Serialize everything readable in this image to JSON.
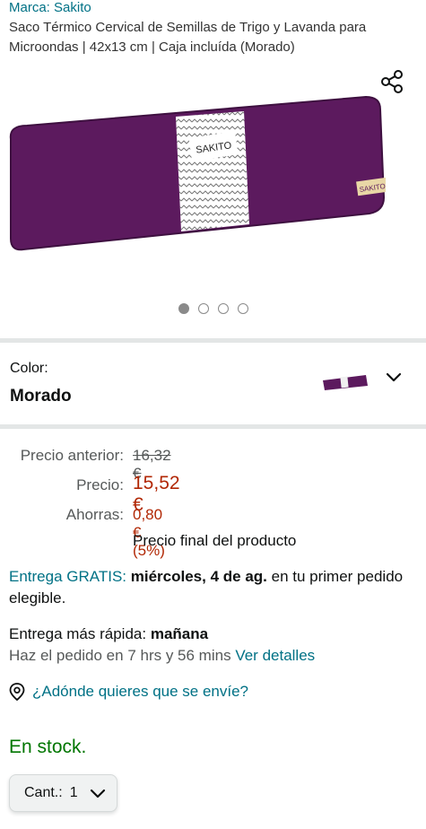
{
  "brand": "Marca: Sakito",
  "title": "Saco Térmico Cervical de Semillas de Trigo y Lavanda para Microondas | 42x13 cm | Caja incluída (Morado)",
  "product_image": {
    "band_text": "SAKITO",
    "tag_text": "SAKITO",
    "color": "#5c1a5e"
  },
  "carousel": {
    "total": 4,
    "active": 1
  },
  "color": {
    "label": "Color:",
    "value": "Morado"
  },
  "prices": {
    "previous_label": "Precio anterior:",
    "previous_value": "16,32 €",
    "price_label": "Precio:",
    "price_value": "15,52 €",
    "savings_label": "Ahorras:",
    "savings_value": "0,80 € (5%)",
    "final_note": "Precio final del producto"
  },
  "delivery": {
    "free_text": "Entrega GRATIS:",
    "date": "miércoles, 4 de ag.",
    "rest": "en tu primer pedido elegible."
  },
  "fastest": {
    "label": "Entrega más rápida:",
    "day": "mañana",
    "order_within": "Haz el pedido en 7 hrs y 56 mins",
    "details_link": "Ver detalles"
  },
  "location_link": "¿Adónde quieres que se envíe?",
  "stock": "En stock.",
  "quantity": {
    "label": "Cant.:",
    "value": "1"
  },
  "icons": {
    "share": "share-icon",
    "pin": "location-pin-icon",
    "chevron": "chevron-down-icon"
  },
  "colors": {
    "link": "#007185",
    "price": "#b12704",
    "stock": "#007600"
  }
}
